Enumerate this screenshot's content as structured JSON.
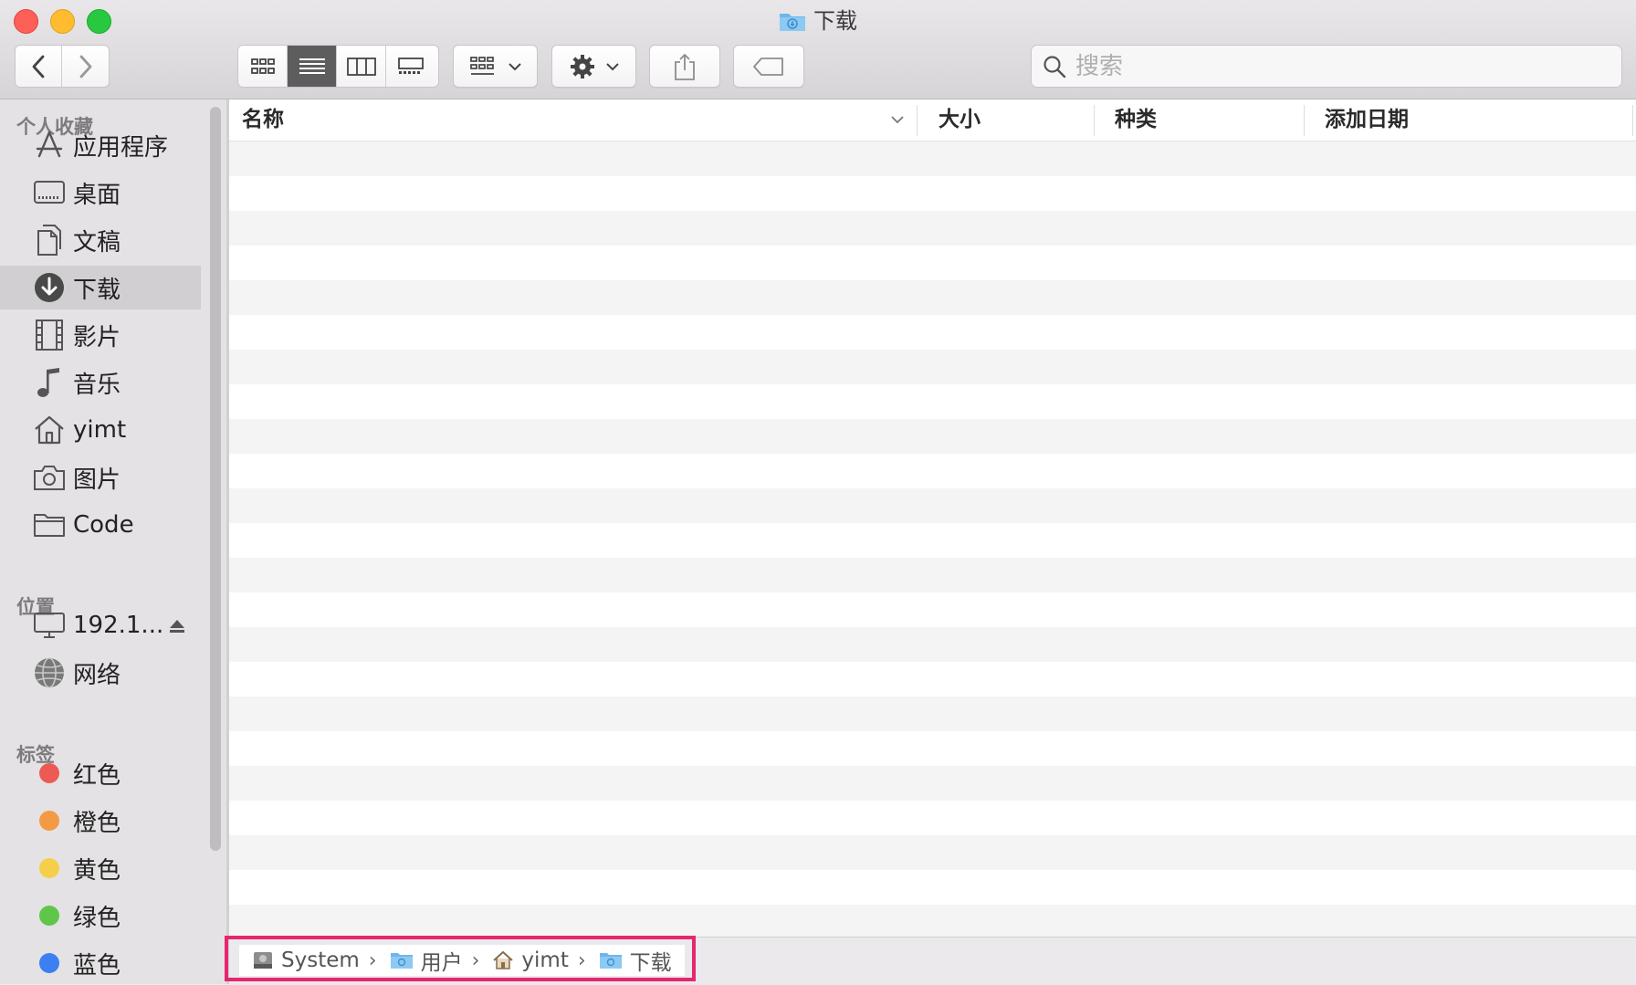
{
  "window": {
    "title": "下载"
  },
  "toolbar": {
    "search_placeholder": "搜索"
  },
  "sidebar": {
    "sections": {
      "favorites": "个人收藏",
      "locations": "位置",
      "tags": "标签"
    },
    "favorites": [
      {
        "label": "应用程序",
        "icon": "applications-icon"
      },
      {
        "label": "桌面",
        "icon": "desktop-icon"
      },
      {
        "label": "文稿",
        "icon": "documents-icon"
      },
      {
        "label": "下载",
        "icon": "downloads-icon",
        "selected": true
      },
      {
        "label": "影片",
        "icon": "movies-icon"
      },
      {
        "label": "音乐",
        "icon": "music-icon"
      },
      {
        "label": "yimt",
        "icon": "home-icon"
      },
      {
        "label": "图片",
        "icon": "pictures-icon"
      },
      {
        "label": "Code",
        "icon": "folder-icon"
      }
    ],
    "locations": [
      {
        "label": "192.1...",
        "icon": "computer-icon",
        "eject": true
      },
      {
        "label": "网络",
        "icon": "network-icon"
      }
    ],
    "tags": [
      {
        "label": "红色",
        "color": "#ec5b53"
      },
      {
        "label": "橙色",
        "color": "#f39a44"
      },
      {
        "label": "黄色",
        "color": "#f6cf4a"
      },
      {
        "label": "绿色",
        "color": "#5fc64a"
      },
      {
        "label": "蓝色",
        "color": "#3b7ff2"
      }
    ]
  },
  "columns": {
    "name": "名称",
    "size": "大小",
    "kind": "种类",
    "date_added": "添加日期"
  },
  "pathbar": {
    "items": [
      "System",
      "用户",
      "yimt",
      "下载"
    ]
  }
}
